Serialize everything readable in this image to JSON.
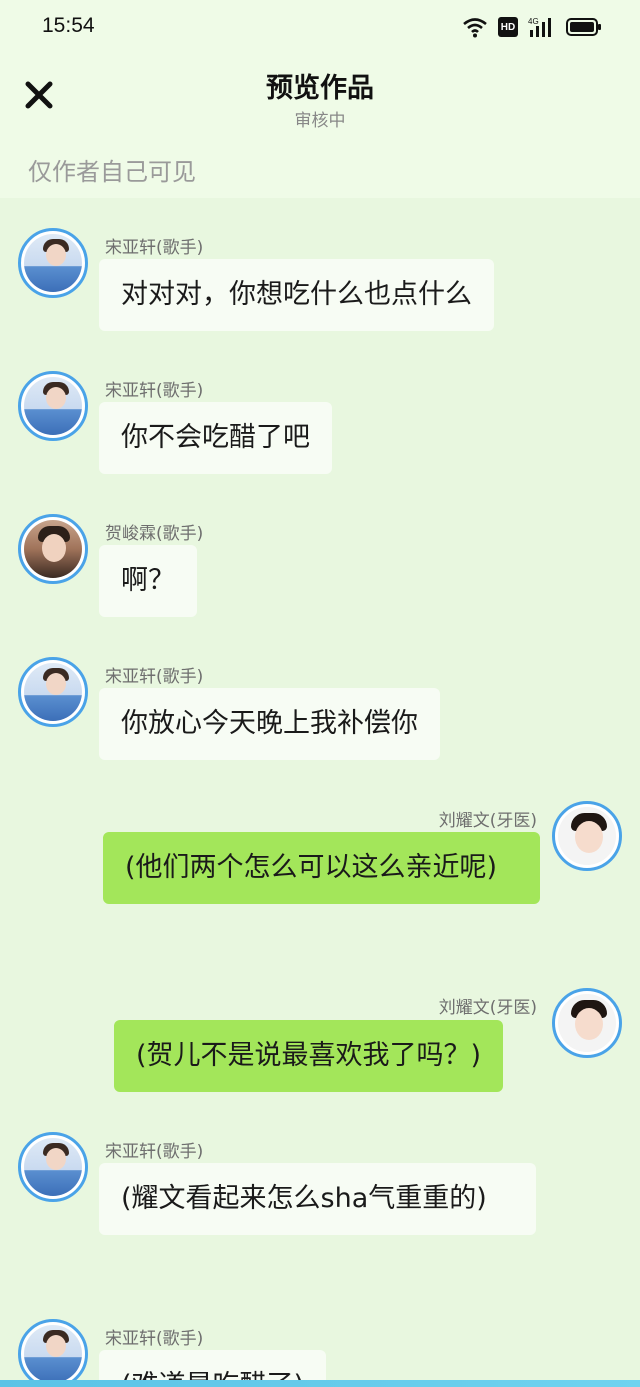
{
  "status_bar": {
    "time": "15:54",
    "hd_label": "HD",
    "net_label": "4G"
  },
  "header": {
    "title": "预览作品",
    "subtitle": "审核中",
    "close_icon": "close-icon"
  },
  "notice": "仅作者自己可见",
  "messages": [
    {
      "side": "left",
      "speaker": "宋亚轩(歌手)",
      "text": "对对对，你想吃什么也点什么",
      "avatar": "song"
    },
    {
      "side": "left",
      "speaker": "宋亚轩(歌手)",
      "text": "你不会吃醋了吧",
      "avatar": "song"
    },
    {
      "side": "left",
      "speaker": "贺峻霖(歌手)",
      "text": "啊？",
      "avatar": "he"
    },
    {
      "side": "left",
      "speaker": "宋亚轩(歌手)",
      "text": "你放心今天晚上我补偿你",
      "avatar": "song"
    },
    {
      "side": "right",
      "speaker": "刘耀文(牙医)",
      "text": "(他们两个怎么可以这么亲近呢)",
      "avatar": "liu"
    },
    {
      "side": "right",
      "speaker": "刘耀文(牙医)",
      "text": "(贺儿不是说最喜欢我了吗？)",
      "avatar": "liu"
    },
    {
      "side": "left",
      "speaker": "宋亚轩(歌手)",
      "text": "(耀文看起来怎么sha气重重的)",
      "avatar": "song"
    },
    {
      "side": "left",
      "speaker": "宋亚轩(歌手)",
      "text": "(难道是吃醋了)",
      "avatar": "song"
    }
  ],
  "colors": {
    "background": "#e8f7df",
    "header_bg": "#effbe7",
    "left_bubble": "#f7fcf4",
    "right_bubble": "#a3e65a",
    "avatar_ring": "#4aa3e8"
  }
}
